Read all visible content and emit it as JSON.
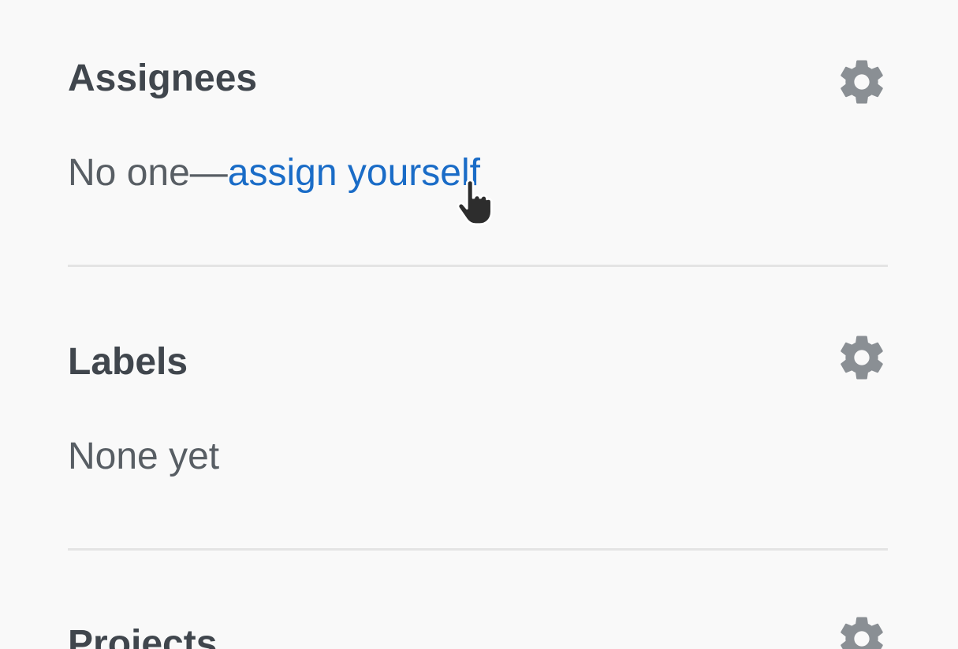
{
  "assignees": {
    "title": "Assignees",
    "empty_prefix": "No one—",
    "assign_link": "assign yourself"
  },
  "labels": {
    "title": "Labels",
    "empty_text": "None yet"
  },
  "projects": {
    "title": "Projects"
  },
  "icons": {
    "settings": "gear-icon",
    "cursor": "hand-pointer-cursor"
  },
  "colors": {
    "link": "#1a6cc7",
    "heading": "#40464d",
    "text": "#585e64",
    "gear": "#8a8f94",
    "divider": "#e4e4e4"
  }
}
